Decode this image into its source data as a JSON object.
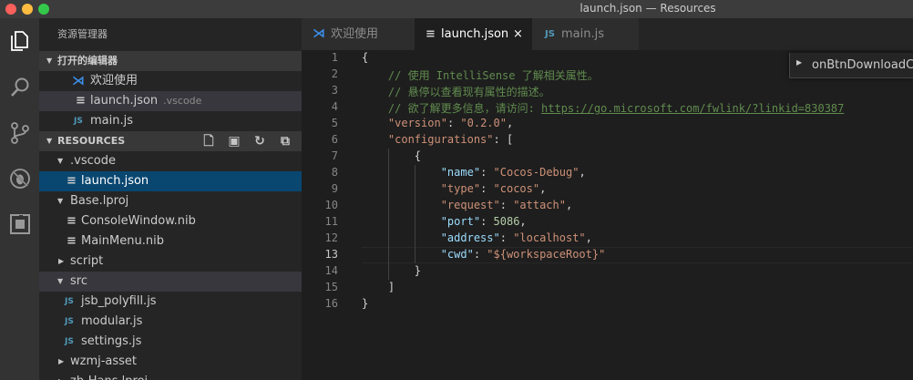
{
  "window": {
    "title": "launch.json — Resources"
  },
  "activity_bar": {
    "icons": [
      "files-icon",
      "search-icon",
      "source-control-icon",
      "debug-icon",
      "extensions-icon"
    ]
  },
  "sidebar": {
    "title": "资源管理器",
    "open_editors": {
      "header": "打开的编辑器",
      "items": [
        {
          "label": "欢迎使用",
          "icon": "vscode-icon"
        },
        {
          "label": "launch.json",
          "detail": ".vscode",
          "icon": "json-icon"
        },
        {
          "label": "main.js",
          "icon": "js-icon",
          "icon_text": "JS"
        }
      ]
    },
    "resources": {
      "header": "RESOURCES",
      "actions": [
        "new-file-icon",
        "new-folder-icon",
        "refresh-icon",
        "collapse-all-icon"
      ],
      "tree": [
        {
          "label": ".vscode",
          "type": "folder",
          "expanded": true
        },
        {
          "label": "launch.json",
          "type": "json",
          "selected": true
        },
        {
          "label": "Base.lproj",
          "type": "folder",
          "expanded": true
        },
        {
          "label": "ConsoleWindow.nib",
          "type": "file"
        },
        {
          "label": "MainMenu.nib",
          "type": "file"
        },
        {
          "label": "script",
          "type": "folder",
          "expanded": false
        },
        {
          "label": "src",
          "type": "folder",
          "expanded": true
        },
        {
          "label": "jsb_polyfill.js",
          "type": "js"
        },
        {
          "label": "modular.js",
          "type": "js"
        },
        {
          "label": "settings.js",
          "type": "js"
        },
        {
          "label": "wzmj-asset",
          "type": "folder",
          "expanded": false
        },
        {
          "label": "zh-Hans.lproj",
          "type": "folder",
          "expanded": false
        }
      ]
    }
  },
  "tabs": [
    {
      "label": "欢迎使用",
      "icon": "vscode-icon",
      "active": false
    },
    {
      "label": "launch.json",
      "icon": "json-icon",
      "active": true,
      "close": "×"
    },
    {
      "label": "main.js",
      "icon": "js-icon",
      "icon_text": "JS",
      "active": false
    }
  ],
  "peek": {
    "label": "onBtnDownloadC..."
  },
  "editor": {
    "current_line": 13,
    "line_numbers": [
      "1",
      "2",
      "3",
      "4",
      "5",
      "6",
      "7",
      "8",
      "9",
      "10",
      "11",
      "12",
      "13",
      "14",
      "15",
      "16"
    ],
    "lines": [
      [
        {
          "t": "{",
          "c": "p"
        }
      ],
      [
        {
          "t": "    // 使用 IntelliSense 了解相关属性。",
          "c": "com"
        }
      ],
      [
        {
          "t": "    // 悬停以查看现有属性的描述。",
          "c": "com"
        }
      ],
      [
        {
          "t": "    // 欲了解更多信息，请访问: ",
          "c": "com"
        },
        {
          "t": "https://go.microsoft.com/fwlink/?linkid=830387",
          "c": "url"
        }
      ],
      [
        {
          "t": "    ",
          "c": "p"
        },
        {
          "t": "\"version\"",
          "c": "str"
        },
        {
          "t": ": ",
          "c": "p"
        },
        {
          "t": "\"0.2.0\"",
          "c": "str"
        },
        {
          "t": ",",
          "c": "p"
        }
      ],
      [
        {
          "t": "    ",
          "c": "p"
        },
        {
          "t": "\"configurations\"",
          "c": "str"
        },
        {
          "t": ": [",
          "c": "p"
        }
      ],
      [
        {
          "t": "        {",
          "c": "p"
        }
      ],
      [
        {
          "t": "            ",
          "c": "p"
        },
        {
          "t": "\"name\"",
          "c": "key"
        },
        {
          "t": ": ",
          "c": "p"
        },
        {
          "t": "\"Cocos-Debug\"",
          "c": "str"
        },
        {
          "t": ",",
          "c": "p"
        }
      ],
      [
        {
          "t": "            ",
          "c": "p"
        },
        {
          "t": "\"type\"",
          "c": "str"
        },
        {
          "t": ": ",
          "c": "p"
        },
        {
          "t": "\"cocos\"",
          "c": "str"
        },
        {
          "t": ",",
          "c": "p"
        }
      ],
      [
        {
          "t": "            ",
          "c": "p"
        },
        {
          "t": "\"request\"",
          "c": "str"
        },
        {
          "t": ": ",
          "c": "p"
        },
        {
          "t": "\"attach\"",
          "c": "str"
        },
        {
          "t": ",",
          "c": "p"
        }
      ],
      [
        {
          "t": "            ",
          "c": "p"
        },
        {
          "t": "\"port\"",
          "c": "key"
        },
        {
          "t": ": ",
          "c": "p"
        },
        {
          "t": "5086",
          "c": "num"
        },
        {
          "t": ",",
          "c": "p"
        }
      ],
      [
        {
          "t": "            ",
          "c": "p"
        },
        {
          "t": "\"address\"",
          "c": "key"
        },
        {
          "t": ": ",
          "c": "p"
        },
        {
          "t": "\"localhost\"",
          "c": "str"
        },
        {
          "t": ",",
          "c": "p"
        }
      ],
      [
        {
          "t": "            ",
          "c": "p"
        },
        {
          "t": "\"cwd\"",
          "c": "key"
        },
        {
          "t": ": ",
          "c": "p"
        },
        {
          "t": "\"${workspaceRoot}\"",
          "c": "str"
        }
      ],
      [
        {
          "t": "        }",
          "c": "p"
        }
      ],
      [
        {
          "t": "    ]",
          "c": "p"
        }
      ],
      [
        {
          "t": "}",
          "c": "p"
        }
      ]
    ]
  },
  "colors": {
    "accent_selection": "#094771",
    "comment": "#608b4e",
    "string": "#ce9178",
    "property": "#9cdcfe",
    "number": "#b5cea8",
    "js_icon": "#519aba",
    "vscode_icon": "#3c8ee8"
  }
}
